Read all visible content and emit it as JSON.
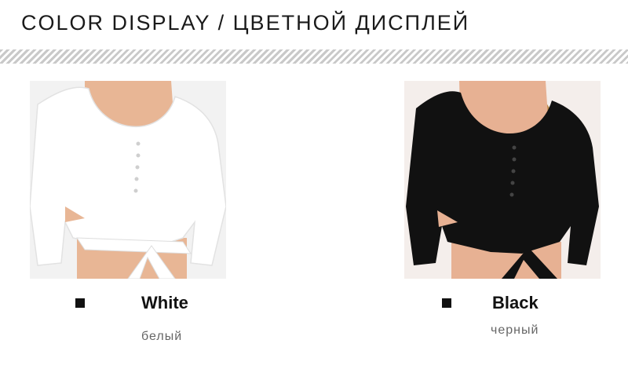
{
  "header": {
    "title": "COLOR DISPLAY / ЦВЕТНОЙ ДИСПЛЕЙ"
  },
  "variants": [
    {
      "name": "White",
      "name_ru": "белый",
      "garment_color": "#ffffff",
      "skin": "#e8b695",
      "hair": "#b07b3e"
    },
    {
      "name": "Black",
      "name_ru": "черный",
      "garment_color": "#111111",
      "skin": "#e7b193",
      "hair": "#b88a4a"
    }
  ],
  "colors": {
    "text": "#111111",
    "subtext": "#666666",
    "divider": "#c9c9c9"
  }
}
